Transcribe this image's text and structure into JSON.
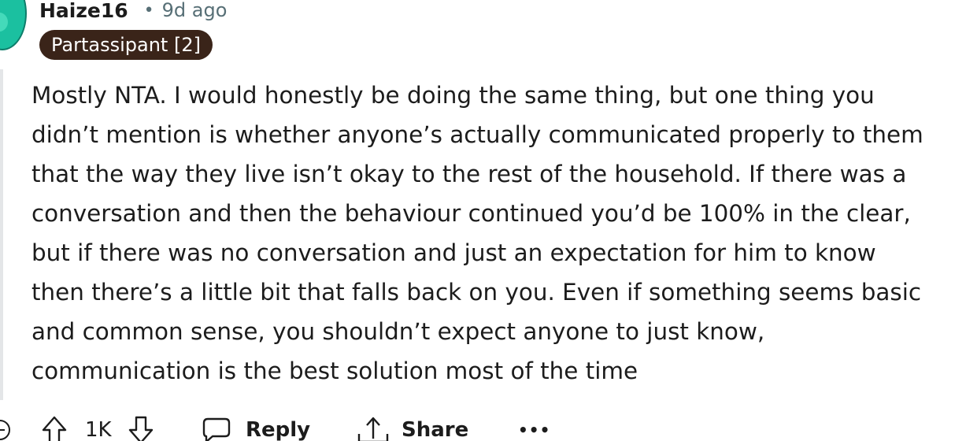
{
  "comment": {
    "author": "Haize16",
    "separator": "•",
    "timestamp": "9d ago",
    "flair": "Partassipant [2]",
    "body_lines": [
      "Mostly NTA. I would honestly be doing the same thing, but one thing you",
      "didn’t mention is whether anyone’s actually communicated properly to them",
      "that the way they live isn’t okay to the rest of the household. If there was a",
      "conversation and then the behaviour continued you’d be 100% in the clear,",
      "but if there was no conversation and just an expectation for him to know",
      "then there’s a little bit that falls back on you. Even if something seems basic",
      "and common sense, you shouldn’t expect anyone to just know,",
      "communication is the best solution most of the time"
    ]
  },
  "actions": {
    "vote_count": "1K",
    "reply_label": "Reply",
    "share_label": "Share",
    "more_label": "•••"
  },
  "icons": {
    "avatar": "avatar-icon",
    "collapse": "collapse-thread-icon",
    "upvote": "upvote-arrow-icon",
    "downvote": "downvote-arrow-icon",
    "reply": "speech-bubble-icon",
    "share": "share-icon",
    "more": "more-options-icon"
  },
  "colors": {
    "avatar": "#1bc0a0",
    "flair_background": "#3a2419",
    "flair_text": "#ffffff",
    "meta_text": "#576f76",
    "body_text": "#1c1c1c"
  }
}
